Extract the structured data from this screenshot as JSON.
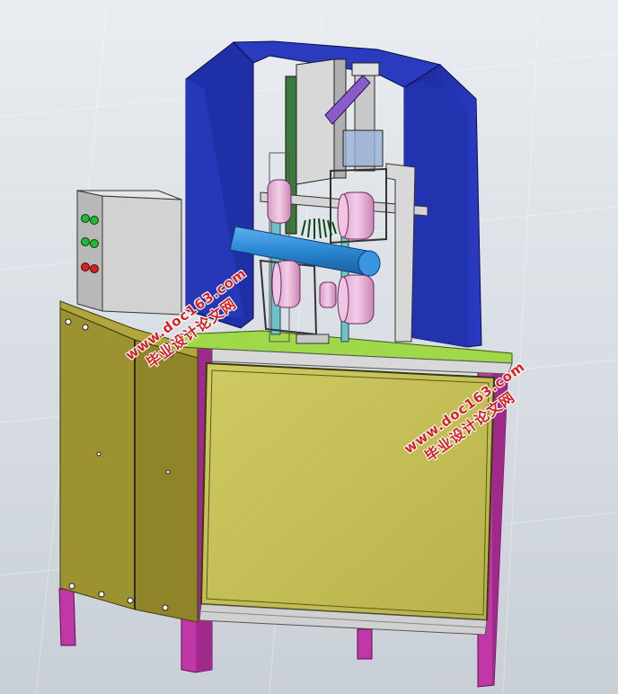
{
  "watermarks": [
    {
      "line1": "www.doc163.com",
      "line2": "毕业设计论文网"
    },
    {
      "line1": "www.doc163.com",
      "line2": "毕业设计论文网"
    }
  ],
  "colors": {
    "background": "#dfe4e9",
    "arch": "#1f2fa8",
    "frame_panel": "#c3bf55",
    "side_panel": "#9d9232",
    "legs": "#c038a8",
    "control_box": "#c8c8c8",
    "tube": "#2a86d2",
    "wheels": "#e8b4d8",
    "brush": "#1a8a3a"
  },
  "indicator_lights": [
    "green",
    "green",
    "green",
    "green",
    "red",
    "red"
  ]
}
